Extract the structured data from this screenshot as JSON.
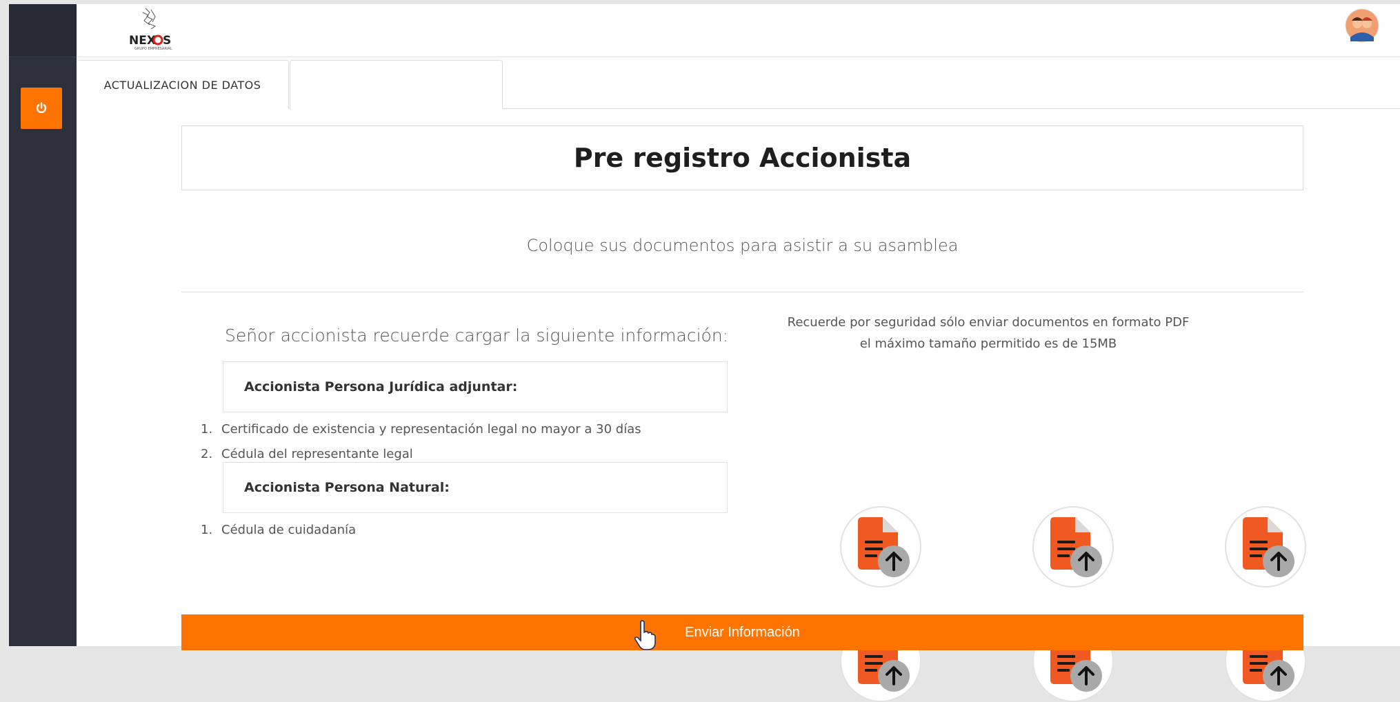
{
  "header": {
    "logo_text": "NEXOS",
    "logo_subtext": "GRUPO EMPRESARIAL"
  },
  "sidebar": {
    "power_icon": "power-icon",
    "accent_color": "#ff7400"
  },
  "tabs": [
    {
      "label": "ACTUALIZACION DE DATOS"
    },
    {
      "label": ""
    }
  ],
  "main": {
    "title": "Pre registro Accionista",
    "subtitle": "Coloque sus documentos para asistir a su asamblea",
    "reminder": "Señor accionista recuerde cargar la siguiente información:",
    "juridica": {
      "heading": "Accionista Persona Jurídica adjuntar:",
      "items": [
        {
          "num": "1.",
          "text": "Certificado de existencia y representación legal no mayor a 30 días"
        },
        {
          "num": "2.",
          "text": "Cédula del representante legal"
        }
      ]
    },
    "natural": {
      "heading": "Accionista Persona Natural:",
      "items": [
        {
          "num": "1.",
          "text": "Cédula de cuidadanía"
        }
      ]
    },
    "pdf_note_line1": "Recuerde por seguridad sólo enviar documentos en formato PDF",
    "pdf_note_line2": "el máximo tamaño permitido es de 15MB",
    "upload_slots": 6,
    "upload_icon": "upload-document-icon",
    "send_button": "Enviar Información"
  }
}
